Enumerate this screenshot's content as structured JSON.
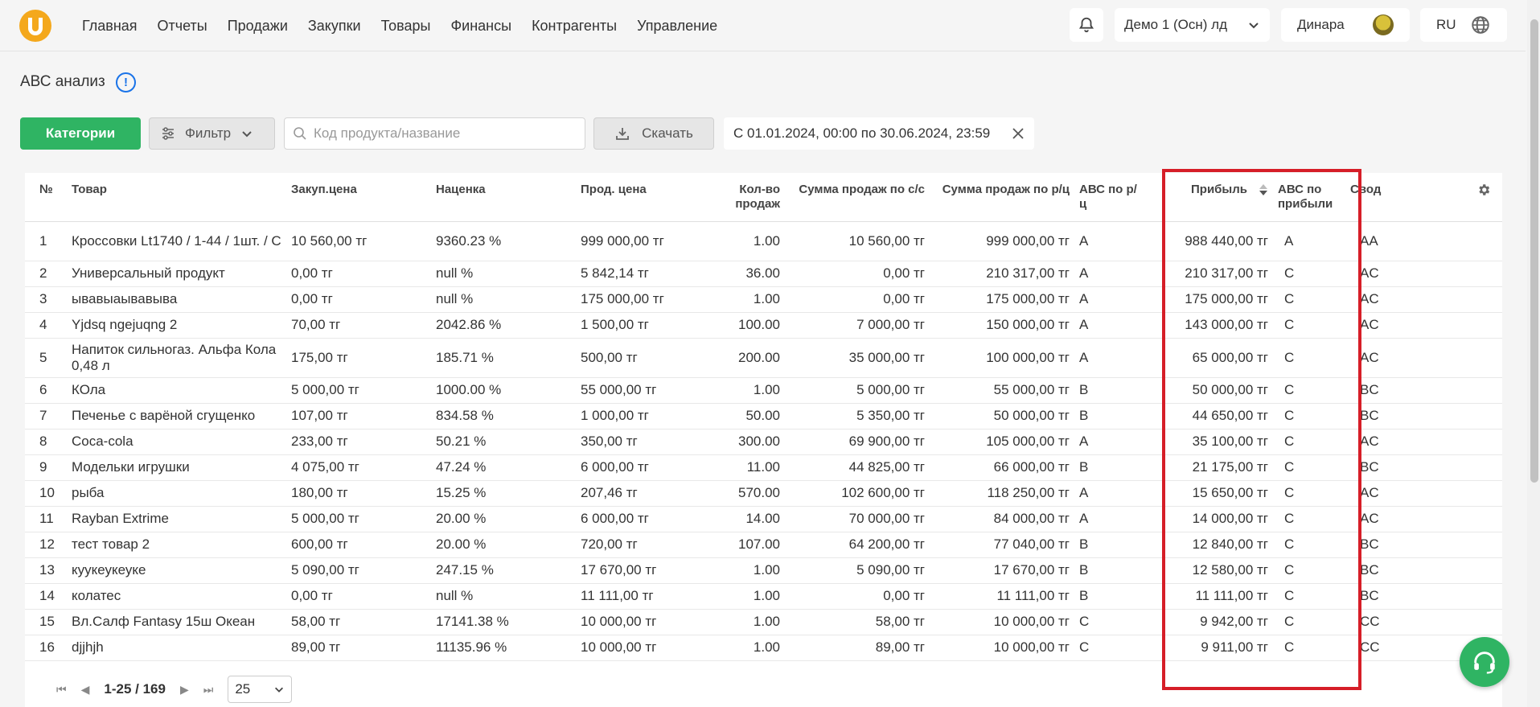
{
  "nav": {
    "logo": "U",
    "items": [
      "Главная",
      "Отчеты",
      "Продажи",
      "Закупки",
      "Товары",
      "Финансы",
      "Контрагенты",
      "Управление"
    ],
    "company": "Демо 1 (Осн) лд",
    "user": "Динара",
    "lang": "RU"
  },
  "page": {
    "title": "АВС анализ",
    "info_icon": "!"
  },
  "toolbar": {
    "categories_label": "Категории",
    "filter_label": "Фильтр",
    "search_placeholder": "Код продукта/название",
    "download_label": "Скачать",
    "date_range": "С 01.01.2024, 00:00 по 30.06.2024, 23:59"
  },
  "table": {
    "headers": {
      "no": "№",
      "name": "Товар",
      "buy": "Закуп.цена",
      "markup": "Наценка",
      "sale": "Прод. цена",
      "qty": "Кол-во продаж",
      "sum_cs": "Сумма продаж по с/с",
      "sum_rc": "Сумма продаж по р/ц",
      "abc_rc": "АВС по р/ц",
      "profit": "Прибыль",
      "abc_profit": "АВС по прибыли",
      "svod": "Свод"
    },
    "rows": [
      [
        "1",
        "Кроссовки Lt1740 / 1-44 / 1шт. / С",
        "10 560,00 тг",
        "9360.23 %",
        "999 000,00 тг",
        "1.00",
        "10 560,00 тг",
        "999 000,00 тг",
        "A",
        "988 440,00 тг",
        "A",
        "AA"
      ],
      [
        "2",
        "Универсальный продукт",
        "0,00 тг",
        "null %",
        "5 842,14 тг",
        "36.00",
        "0,00 тг",
        "210 317,00 тг",
        "A",
        "210 317,00 тг",
        "C",
        "AC"
      ],
      [
        "3",
        "ывавыаывавыва",
        "0,00 тг",
        "null %",
        "175 000,00 тг",
        "1.00",
        "0,00 тг",
        "175 000,00 тг",
        "A",
        "175 000,00 тг",
        "C",
        "AC"
      ],
      [
        "4",
        "Yjdsq ngejuqng 2",
        "70,00 тг",
        "2042.86 %",
        "1 500,00 тг",
        "100.00",
        "7 000,00 тг",
        "150 000,00 тг",
        "A",
        "143 000,00 тг",
        "C",
        "AC"
      ],
      [
        "5",
        "Напиток сильногаз. Альфа Кола 0,48 л",
        "175,00 тг",
        "185.71 %",
        "500,00 тг",
        "200.00",
        "35 000,00 тг",
        "100 000,00 тг",
        "A",
        "65 000,00 тг",
        "C",
        "AC"
      ],
      [
        "6",
        "КОла",
        "5 000,00 тг",
        "1000.00 %",
        "55 000,00 тг",
        "1.00",
        "5 000,00 тг",
        "55 000,00 тг",
        "B",
        "50 000,00 тг",
        "C",
        "BC"
      ],
      [
        "7",
        "Печенье с варёной сгущенко",
        "107,00 тг",
        "834.58 %",
        "1 000,00 тг",
        "50.00",
        "5 350,00 тг",
        "50 000,00 тг",
        "B",
        "44 650,00 тг",
        "C",
        "BC"
      ],
      [
        "8",
        "Coca-cola",
        "233,00 тг",
        "50.21 %",
        "350,00 тг",
        "300.00",
        "69 900,00 тг",
        "105 000,00 тг",
        "A",
        "35 100,00 тг",
        "C",
        "AC"
      ],
      [
        "9",
        "Модельки игрушки",
        "4 075,00 тг",
        "47.24 %",
        "6 000,00 тг",
        "11.00",
        "44 825,00 тг",
        "66 000,00 тг",
        "B",
        "21 175,00 тг",
        "C",
        "BC"
      ],
      [
        "10",
        "рыба",
        "180,00 тг",
        "15.25 %",
        "207,46 тг",
        "570.00",
        "102 600,00 тг",
        "118 250,00 тг",
        "A",
        "15 650,00 тг",
        "C",
        "AC"
      ],
      [
        "11",
        "Rayban Extrime",
        "5 000,00 тг",
        "20.00 %",
        "6 000,00 тг",
        "14.00",
        "70 000,00 тг",
        "84 000,00 тг",
        "A",
        "14 000,00 тг",
        "C",
        "AC"
      ],
      [
        "12",
        "тест товар 2",
        "600,00 тг",
        "20.00 %",
        "720,00 тг",
        "107.00",
        "64 200,00 тг",
        "77 040,00 тг",
        "B",
        "12 840,00 тг",
        "C",
        "BC"
      ],
      [
        "13",
        "куукеукеуке",
        "5 090,00 тг",
        "247.15 %",
        "17 670,00 тг",
        "1.00",
        "5 090,00 тг",
        "17 670,00 тг",
        "B",
        "12 580,00 тг",
        "C",
        "BC"
      ],
      [
        "14",
        "колатес",
        "0,00 тг",
        "null %",
        "11 111,00 тг",
        "1.00",
        "0,00 тг",
        "11 111,00 тг",
        "B",
        "11 111,00 тг",
        "C",
        "BC"
      ],
      [
        "15",
        "Вл.Салф Fantasy 15ш Океан",
        "58,00 тг",
        "17141.38 %",
        "10 000,00 тг",
        "1.00",
        "58,00 тг",
        "10 000,00 тг",
        "C",
        "9 942,00 тг",
        "C",
        "CC"
      ],
      [
        "16",
        "djjhjh",
        "89,00 тг",
        "11135.96 %",
        "10 000,00 тг",
        "1.00",
        "89,00 тг",
        "10 000,00 тг",
        "C",
        "9 911,00 тг",
        "C",
        "CC"
      ]
    ]
  },
  "pagination": {
    "range": "1-25 / 169",
    "page_size": "25"
  },
  "colors": {
    "accent_green": "#2fb463",
    "logo_orange": "#f4a81c",
    "highlight_red": "#d61e28",
    "info_blue": "#1a73e8"
  }
}
